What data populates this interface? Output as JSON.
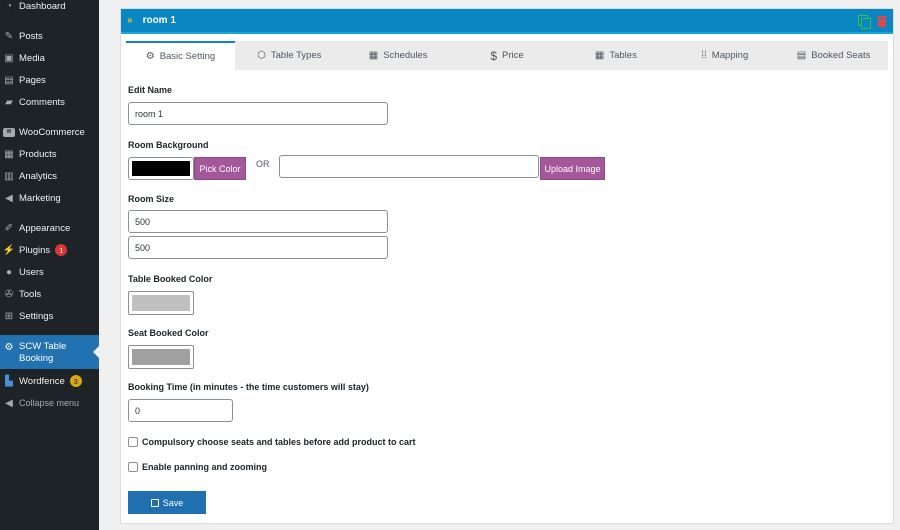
{
  "sidebar": {
    "items": [
      {
        "label": "Dashboard",
        "icon": "dashboard-icon"
      },
      {
        "label": "Posts",
        "icon": "pin-icon"
      },
      {
        "label": "Media",
        "icon": "media-icon"
      },
      {
        "label": "Pages",
        "icon": "pages-icon"
      },
      {
        "label": "Comments",
        "icon": "comment-icon"
      },
      {
        "label": "WooCommerce",
        "icon": "woo-icon"
      },
      {
        "label": "Products",
        "icon": "archive-icon"
      },
      {
        "label": "Analytics",
        "icon": "chart-icon"
      },
      {
        "label": "Marketing",
        "icon": "megaphone-icon"
      },
      {
        "label": "Appearance",
        "icon": "brush-icon"
      },
      {
        "label": "Plugins",
        "icon": "plug-icon",
        "badge": "1"
      },
      {
        "label": "Users",
        "icon": "user-icon"
      },
      {
        "label": "Tools",
        "icon": "wrench-icon"
      },
      {
        "label": "Settings",
        "icon": "settings-icon"
      },
      {
        "label": "SCW Table Booking",
        "icon": "gear-icon"
      },
      {
        "label": "Wordfence",
        "icon": "wordfence-icon",
        "badge": "3"
      },
      {
        "label": "Collapse menu",
        "icon": "collapse-icon"
      }
    ]
  },
  "panel": {
    "title": "room 1",
    "tabs": [
      {
        "label": "Basic Setting",
        "icon": "gear-icon"
      },
      {
        "label": "Table Types",
        "icon": "cube-icon"
      },
      {
        "label": "Schedules",
        "icon": "calendar-icon"
      },
      {
        "label": "Price",
        "icon": "dollar-icon"
      },
      {
        "label": "Tables",
        "icon": "grid-icon"
      },
      {
        "label": "Mapping",
        "icon": "mapping-icon"
      },
      {
        "label": "Booked Seats",
        "icon": "document-icon"
      }
    ]
  },
  "form": {
    "edit_name_label": "Edit Name",
    "edit_name_value": "room 1",
    "room_bg_label": "Room Background",
    "pick_color_label": "Pick Color",
    "or_label": "OR",
    "upload_image_label": "Upload Image",
    "room_size_label": "Room Size",
    "room_width_value": "500",
    "room_height_value": "500",
    "table_booked_color_label": "Table Booked Color",
    "seat_booked_color_label": "Seat Booked Color",
    "booking_time_label": "Booking Time (in minutes - the time customers will stay)",
    "booking_time_value": "0",
    "compulsory_label": "Compulsory choose seats and tables before add product to cart",
    "panning_label": "Enable panning and zooming",
    "save_label": "Save"
  },
  "colors": {
    "room_bg": "#000000",
    "table_booked": "#c0c0c0",
    "seat_booked": "#a0a0a0",
    "header_blue": "#0a86c2",
    "accent_purple": "#a5579b"
  }
}
